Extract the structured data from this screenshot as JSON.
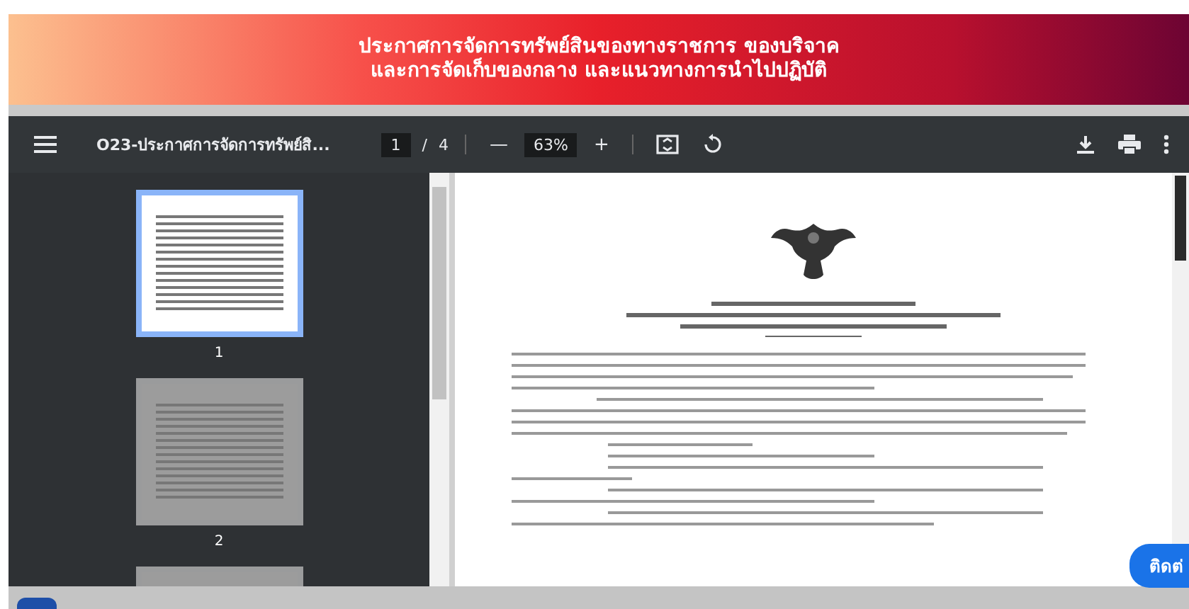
{
  "banner": {
    "title_lines": [
      "ประกาศการจัดการทรัพย์สินของทางราชการ ของบริจาค",
      "และการจัดเก็บของกลาง และแนวทางการนำไปปฏิบัติ"
    ]
  },
  "viewer": {
    "file_name": "O23-ประกาศการจัดการทรัพย์สิ...",
    "page": "1",
    "separator": "/",
    "page_count": "4",
    "zoom": "63%",
    "minus": "—",
    "plus": "+",
    "thumbnails": [
      {
        "label": "1",
        "selected": true
      },
      {
        "label": "2",
        "selected": false
      },
      {
        "selected": false
      }
    ]
  },
  "contact_button": {
    "label": "ติดต่"
  }
}
